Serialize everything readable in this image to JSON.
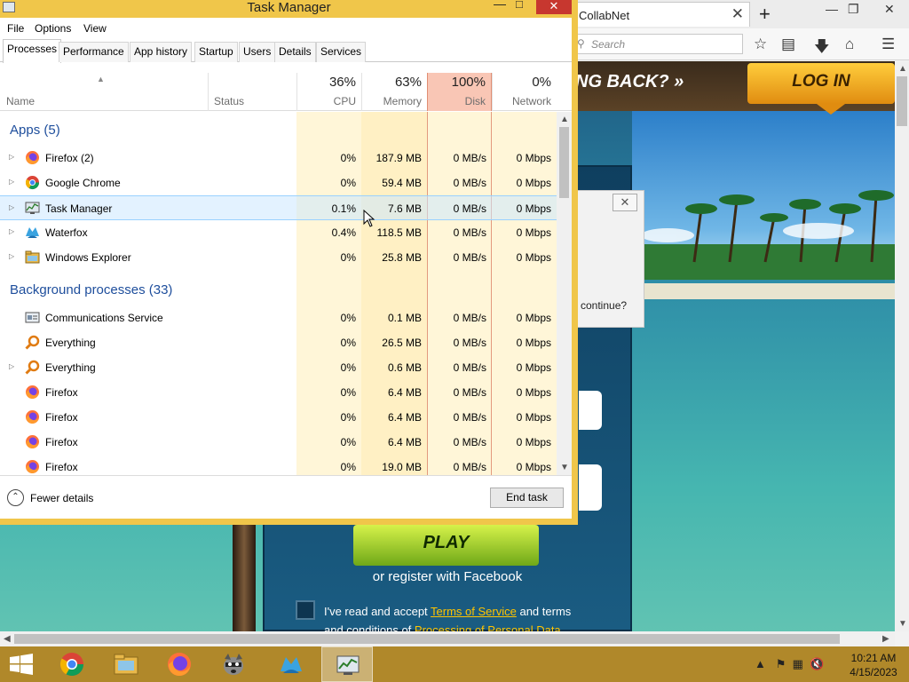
{
  "browser": {
    "tab_title": "CollabNet",
    "tab_close": "✕",
    "new_tab": "+",
    "window_controls": [
      "—",
      "❐",
      "✕"
    ],
    "search_placeholder": "Search",
    "toolbar_icons": [
      "star-icon",
      "clipboard-icon",
      "download-icon",
      "home-icon",
      "menu-icon"
    ]
  },
  "game_page": {
    "banner": "NG BACK? »",
    "login_label": "LOG IN",
    "dialog_text": "continue?",
    "dialog_close": "✕",
    "play_label": "PLAY",
    "register_text": "or register with Facebook",
    "terms_prefix": "I've read and accept ",
    "terms_link": "Terms of Service",
    "terms_middle": " and terms and conditions of ",
    "privacy_link": "Processing of Personal Data"
  },
  "taskbar": {
    "apps": [
      "start-button",
      "chrome",
      "file-explorer",
      "firefox",
      "raccoon-app",
      "waterfox",
      "task-manager"
    ],
    "active_app": "task-manager",
    "clock_time": "10:21 AM",
    "clock_date": "4/15/2023"
  },
  "task_manager": {
    "title": "Task Manager",
    "menu": [
      "File",
      "Options",
      "View"
    ],
    "tabs": [
      "Processes",
      "Performance",
      "App history",
      "Startup",
      "Users",
      "Details",
      "Services"
    ],
    "active_tab": "Processes",
    "columns": {
      "name": "Name",
      "status": "Status",
      "cpu": {
        "pct": "36%",
        "label": "CPU"
      },
      "memory": {
        "pct": "63%",
        "label": "Memory"
      },
      "disk": {
        "pct": "100%",
        "label": "Disk"
      },
      "network": {
        "pct": "0%",
        "label": "Network"
      }
    },
    "apps_group": {
      "title": "Apps (5)",
      "rows": [
        {
          "name": "Firefox (2)",
          "cpu": "0%",
          "memory": "187.9 MB",
          "disk": "0 MB/s",
          "network": "0 Mbps",
          "expandable": true,
          "icon": "firefox-icon"
        },
        {
          "name": "Google Chrome",
          "cpu": "0%",
          "memory": "59.4 MB",
          "disk": "0 MB/s",
          "network": "0 Mbps",
          "expandable": true,
          "icon": "chrome-icon"
        },
        {
          "name": "Task Manager",
          "cpu": "0.1%",
          "memory": "7.6 MB",
          "disk": "0 MB/s",
          "network": "0 Mbps",
          "expandable": true,
          "icon": "task-manager-icon"
        },
        {
          "name": "Waterfox",
          "cpu": "0.4%",
          "memory": "118.5 MB",
          "disk": "0 MB/s",
          "network": "0 Mbps",
          "expandable": true,
          "icon": "waterfox-icon"
        },
        {
          "name": "Windows Explorer",
          "cpu": "0%",
          "memory": "25.8 MB",
          "disk": "0 MB/s",
          "network": "0 Mbps",
          "expandable": true,
          "icon": "folder-icon"
        }
      ]
    },
    "background_group": {
      "title": "Background processes (33)",
      "rows": [
        {
          "name": "Communications Service",
          "cpu": "0%",
          "memory": "0.1 MB",
          "disk": "0 MB/s",
          "network": "0 Mbps",
          "expandable": false,
          "icon": "service-icon"
        },
        {
          "name": "Everything",
          "cpu": "0%",
          "memory": "26.5 MB",
          "disk": "0 MB/s",
          "network": "0 Mbps",
          "expandable": false,
          "icon": "magnifier-icon"
        },
        {
          "name": "Everything",
          "cpu": "0%",
          "memory": "0.6 MB",
          "disk": "0 MB/s",
          "network": "0 Mbps",
          "expandable": true,
          "icon": "magnifier-icon"
        },
        {
          "name": "Firefox",
          "cpu": "0%",
          "memory": "6.4 MB",
          "disk": "0 MB/s",
          "network": "0 Mbps",
          "expandable": false,
          "icon": "firefox-icon"
        },
        {
          "name": "Firefox",
          "cpu": "0%",
          "memory": "6.4 MB",
          "disk": "0 MB/s",
          "network": "0 Mbps",
          "expandable": false,
          "icon": "firefox-icon"
        },
        {
          "name": "Firefox",
          "cpu": "0%",
          "memory": "6.4 MB",
          "disk": "0 MB/s",
          "network": "0 Mbps",
          "expandable": false,
          "icon": "firefox-icon"
        },
        {
          "name": "Firefox",
          "cpu": "0%",
          "memory": "19.0 MB",
          "disk": "0 MB/s",
          "network": "0 Mbps",
          "expandable": false,
          "icon": "firefox-icon"
        }
      ]
    },
    "selected_row": "Task Manager",
    "fewer_details": "Fewer details",
    "end_task": "End task"
  },
  "colors": {
    "titlebar": "#f0c64a",
    "taskbar": "#b0882a",
    "group_heading": "#1e4e9c",
    "disk_header": "#f9c6b5",
    "close_button": "#c7372f"
  }
}
